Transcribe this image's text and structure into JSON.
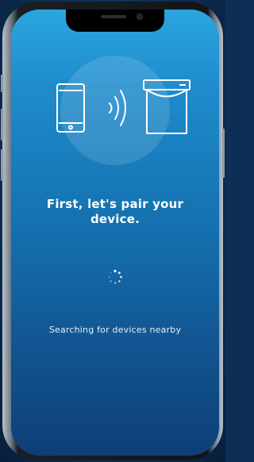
{
  "screen": {
    "title": "First, let's pair your device.",
    "status_text": "Searching for devices nearby"
  },
  "icons": {
    "phone": "smartphone-icon",
    "signal": "wireless-signal-icon",
    "bin": "smart-bin-device-icon",
    "loader": "loading-spinner-icon"
  },
  "colors": {
    "gradient_top": "#2aa6df",
    "gradient_bottom": "#0e3f76",
    "text": "#ffffff"
  }
}
